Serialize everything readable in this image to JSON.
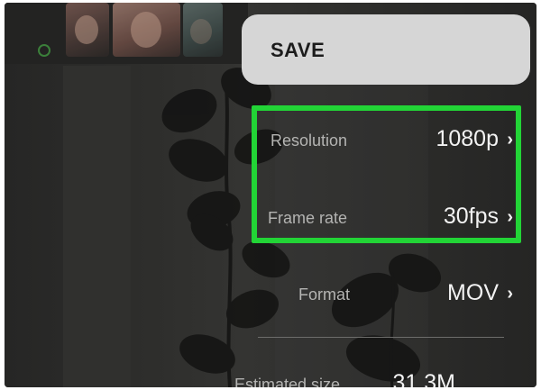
{
  "save_sheet": {
    "title": "SAVE"
  },
  "export_settings": {
    "rows": [
      {
        "label": "Resolution",
        "value": "1080p"
      },
      {
        "label": "Frame rate",
        "value": "30fps"
      },
      {
        "label": "Format",
        "value": "MOV"
      },
      {
        "label": "Estimated size",
        "value": "31.3M"
      }
    ]
  },
  "colors": {
    "highlight": "#22d436",
    "save_sheet_bg": "#d6d6d6",
    "panel_bg": "#2a2a29"
  },
  "icons": {
    "chevron": "chevron-right-icon"
  }
}
